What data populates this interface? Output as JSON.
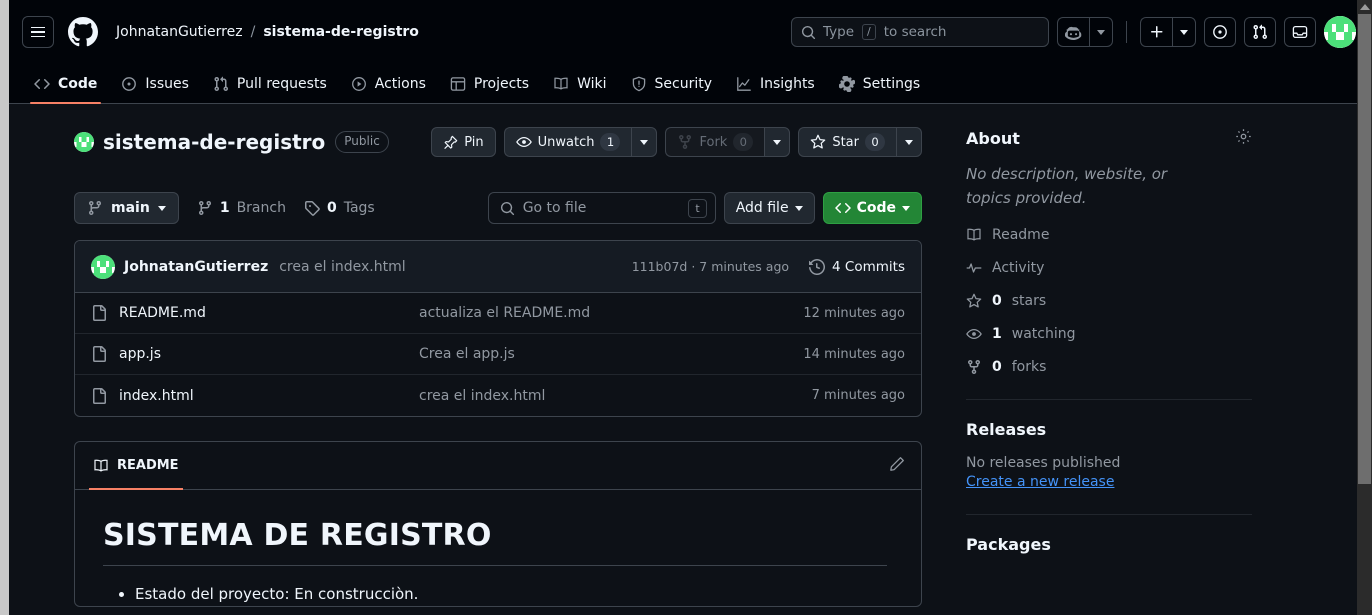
{
  "header": {
    "hamburger_label": "menu-toggle",
    "logo": "github-mark",
    "breadcrumb": {
      "owner": "JohnatanGutierrez",
      "separator": "/",
      "repo": "sistema-de-registro"
    },
    "search": {
      "prefix": "Type",
      "key": "/",
      "suffix": "to search",
      "placeholder": "Type / to search"
    },
    "icons": {
      "copilot": "copilot-icon",
      "copilot_caret": "chevron-down-icon",
      "create_new": "plus-icon",
      "create_caret": "chevron-down-icon",
      "issues": "issue-opened-icon",
      "pull_requests": "git-pull-request-icon",
      "inbox": "inbox-icon",
      "avatar": "user-avatar"
    }
  },
  "repo_nav": {
    "tabs": [
      {
        "label": "Code",
        "icon": "code-icon",
        "active": true
      },
      {
        "label": "Issues",
        "icon": "issue-opened-icon",
        "active": false
      },
      {
        "label": "Pull requests",
        "icon": "git-pull-request-icon",
        "active": false
      },
      {
        "label": "Actions",
        "icon": "play-icon",
        "active": false
      },
      {
        "label": "Projects",
        "icon": "table-icon",
        "active": false
      },
      {
        "label": "Wiki",
        "icon": "book-icon",
        "active": false
      },
      {
        "label": "Security",
        "icon": "shield-icon",
        "active": false
      },
      {
        "label": "Insights",
        "icon": "graph-icon",
        "active": false
      },
      {
        "label": "Settings",
        "icon": "gear-icon",
        "active": false
      }
    ]
  },
  "repo": {
    "name": "sistema-de-registro",
    "visibility": "Public",
    "actions": {
      "pin": "Pin",
      "watch": "Unwatch",
      "watch_count": "1",
      "fork": "Fork",
      "fork_count": "0",
      "star": "Star",
      "star_count": "0"
    }
  },
  "toolbar": {
    "branch": "main",
    "branch_count": "1",
    "branch_label": "Branch",
    "tags_count": "0",
    "tags_label": "Tags",
    "go_to_file_placeholder": "Go to file",
    "go_to_file_key": "t",
    "add_file": "Add file",
    "code_button": "Code"
  },
  "commit_bar": {
    "author": "JohnatanGutierrez",
    "message": "crea el index.html",
    "sha": "111b07d",
    "sha_separator": "·",
    "time": "7 minutes ago",
    "commits_count": "4 Commits"
  },
  "files": [
    {
      "icon": "file-icon",
      "name": "README.md",
      "message": "actualiza el README.md",
      "time": "12 minutes ago"
    },
    {
      "icon": "file-icon",
      "name": "app.js",
      "message": "Crea el app.js",
      "time": "14 minutes ago"
    },
    {
      "icon": "file-icon",
      "name": "index.html",
      "message": "crea el index.html",
      "time": "7 minutes ago"
    }
  ],
  "readme": {
    "tab_label": "README",
    "edit_icon": "pencil-icon",
    "heading": "SISTEMA DE REGISTRO",
    "bullets": [
      "Estado del proyecto: En construcciòn."
    ]
  },
  "sidebar": {
    "about": {
      "title": "About",
      "settings_icon": "gear-icon",
      "description": "No description, website, or topics provided.",
      "links": [
        {
          "icon": "book-icon",
          "label": "Readme"
        },
        {
          "icon": "pulse-icon",
          "label": "Activity"
        }
      ],
      "stats": [
        {
          "icon": "star-icon",
          "count": "0",
          "label": "stars"
        },
        {
          "icon": "eye-icon",
          "count": "1",
          "label": "watching"
        },
        {
          "icon": "fork-icon",
          "count": "0",
          "label": "forks"
        }
      ]
    },
    "releases": {
      "title": "Releases",
      "empty": "No releases published",
      "create_link": "Create a new release"
    },
    "packages": {
      "title": "Packages"
    }
  },
  "colors": {
    "accent_green": "#238636",
    "active_underline": "#f78166",
    "link_blue": "#4493f8",
    "header_bg": "#010409",
    "page_bg": "#0d1117"
  }
}
